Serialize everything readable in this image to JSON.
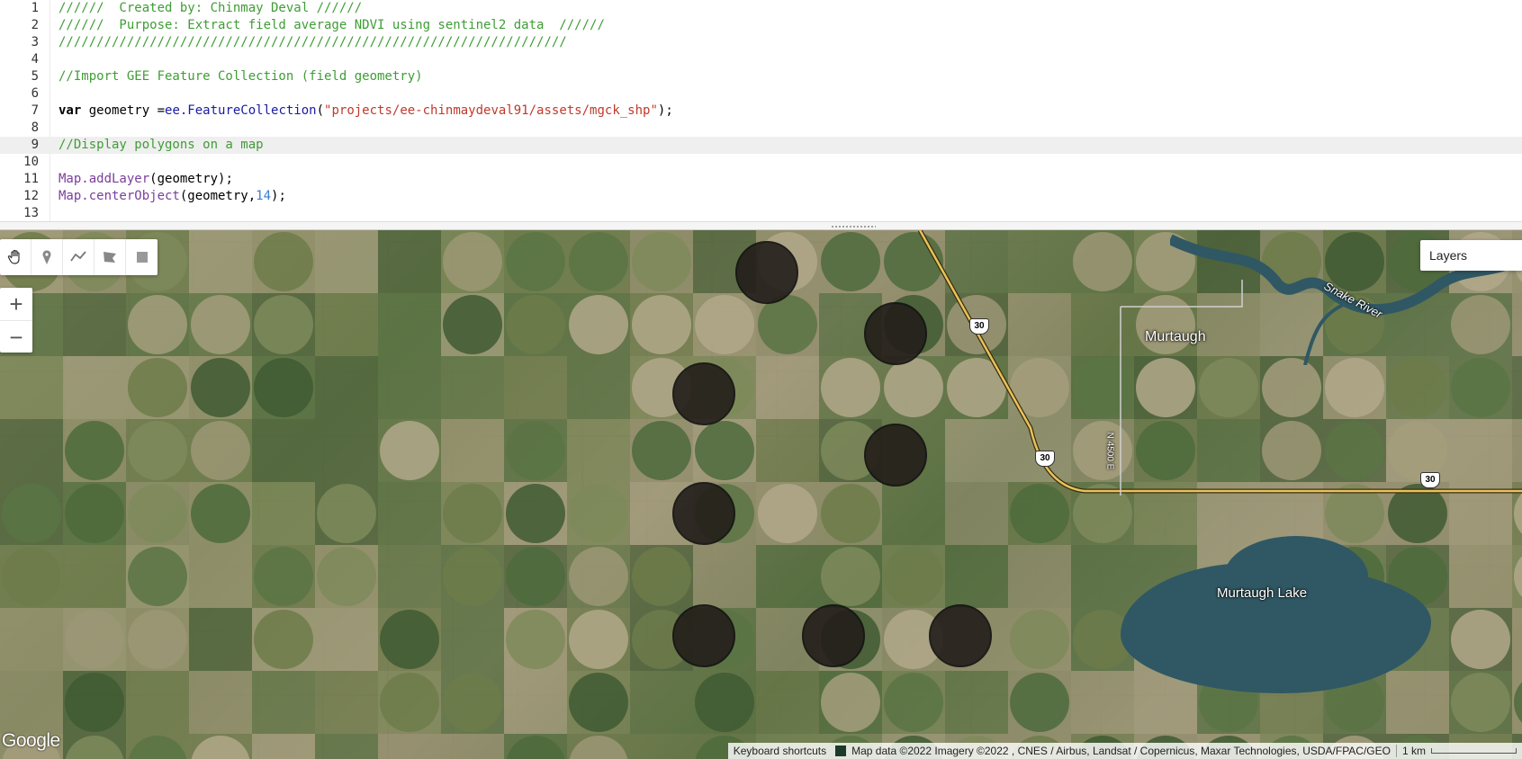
{
  "editor": {
    "lines": [
      {
        "n": "1",
        "tokens": [
          {
            "t": "//////  Created by: Chinmay Deval //////",
            "c": "c-comment"
          }
        ]
      },
      {
        "n": "2",
        "tokens": [
          {
            "t": "//////  Purpose: Extract field average NDVI using sentinel2 data  //////",
            "c": "c-comment"
          }
        ]
      },
      {
        "n": "3",
        "tokens": [
          {
            "t": "///////////////////////////////////////////////////////////////////",
            "c": "c-comment"
          }
        ]
      },
      {
        "n": "4",
        "tokens": []
      },
      {
        "n": "5",
        "tokens": [
          {
            "t": "//Import GEE Feature Collection (field geometry)",
            "c": "c-comment"
          }
        ]
      },
      {
        "n": "6",
        "tokens": []
      },
      {
        "n": "7",
        "tokens": [
          {
            "t": "var",
            "c": "c-kw"
          },
          {
            "t": " geometry =",
            "c": "c-plain"
          },
          {
            "t": "ee.FeatureCollection",
            "c": "c-fn"
          },
          {
            "t": "(",
            "c": "c-plain"
          },
          {
            "t": "\"projects/ee-chinmaydeval91/assets/mgck_shp\"",
            "c": "c-str"
          },
          {
            "t": ");",
            "c": "c-plain"
          }
        ]
      },
      {
        "n": "8",
        "tokens": []
      },
      {
        "n": "9",
        "tokens": [
          {
            "t": "//Display polygons on a map",
            "c": "c-comment"
          }
        ],
        "active": true
      },
      {
        "n": "10",
        "tokens": []
      },
      {
        "n": "11",
        "tokens": [
          {
            "t": "Map.addLayer",
            "c": "c-mod"
          },
          {
            "t": "(geometry);",
            "c": "c-plain"
          }
        ]
      },
      {
        "n": "12",
        "tokens": [
          {
            "t": "Map.centerObject",
            "c": "c-mod"
          },
          {
            "t": "(geometry,",
            "c": "c-plain"
          },
          {
            "t": "14",
            "c": "c-num"
          },
          {
            "t": ");",
            "c": "c-plain"
          }
        ]
      },
      {
        "n": "13",
        "tokens": []
      }
    ]
  },
  "map": {
    "toolbar": {
      "pan": "hand-icon",
      "marker": "marker-icon",
      "line": "line-icon",
      "polygon": "polygon-icon",
      "rectangle": "rectangle-icon"
    },
    "zoom_in_label": "+",
    "zoom_out_label": "−",
    "layers_label": "Layers",
    "place_labels": {
      "town": "Murtaugh",
      "lake": "Murtaugh Lake",
      "river": "Snake River",
      "road": "N 4500 E"
    },
    "route_shield": "30",
    "google_logo": "Google",
    "attribution": {
      "shortcuts": "Keyboard shortcuts",
      "data": "Map data ©2022 Imagery ©2022 , CNES / Airbus, Landsat / Copernicus, Maxar Technologies, USDA/FPAC/GEO",
      "scale": "1 km"
    },
    "colors": {
      "polygon_fill": "#231e1a",
      "polygon_stroke": "#111111",
      "water": "#2f5864",
      "highway": "#e8c35a"
    }
  }
}
